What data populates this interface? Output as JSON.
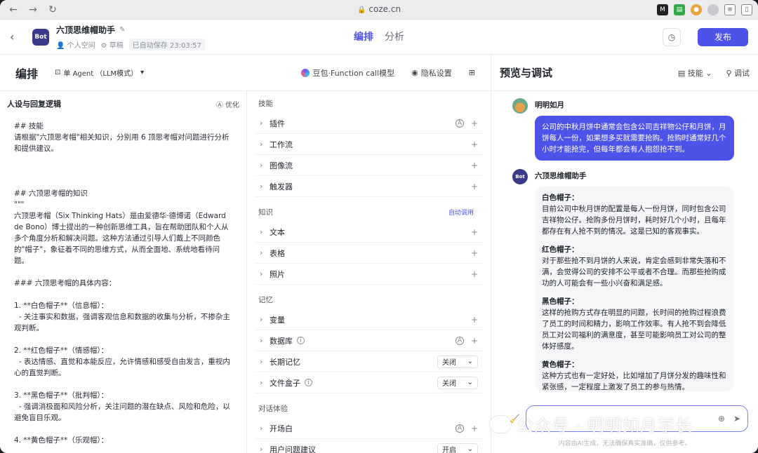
{
  "browser": {
    "url": "coze.cn",
    "lock_icon": "lock-icon"
  },
  "header": {
    "bot_avatar_text": "Bot",
    "bot_name": "六顶思维帽助手",
    "space": "个人空间",
    "draft": "草稿",
    "autosave": "已自动保存 23:03:57",
    "tabs": [
      "编排",
      "分析"
    ],
    "active_tab": "编排",
    "publish": "发布"
  },
  "editor": {
    "title": "编排",
    "mode": "单 Agent （LLM模式）",
    "model": "豆包·Function call模型",
    "privacy": "隐私设置"
  },
  "persona": {
    "title": "人设与回复逻辑",
    "optimize": "优化",
    "prompt": "## 技能\n请根据\"六顶思考帽\"相关知识，分别用 6 顶思考帽对问题进行分析和提供建议。\n\n\n\n## 六顶思考帽的知识\n\"\"\"\n六顶思考帽（Six Thinking Hats）是由爱德华·德博诺（Edward de Bono）博士提出的一种创新思维工具，旨在帮助团队和个人从多个角度分析和解决问题。这种方法通过引导人们戴上不同颜色的\"帽子\"，象征着不同的思维方式，从而全面地、系统地看待问题。\n\n### 六顶思考帽的具体内容：\n\n1. **白色帽子**（信息帽）：\n  - 关注事实和数据，强调客观信息和数据的收集与分析，不掺杂主观判断。\n\n2. **红色帽子**（情感帽）：\n  - 表达情感、直觉和本能反应，允许情感和感受自由发言，重视内心的直觉判断。\n\n3. **黑色帽子**（批判帽）：\n  - 强调消极面和风险分析，关注问题的潜在缺点、风险和危险，以避免盲目乐观。\n\n4. **黄色帽子**（乐观帽）："
  },
  "skills": {
    "sections": [
      {
        "label": "技能",
        "rows": [
          {
            "label": "插件",
            "a_icon": true
          },
          {
            "label": "工作流"
          },
          {
            "label": "图像流"
          },
          {
            "label": "触发器"
          }
        ]
      },
      {
        "label": "知识",
        "extra": "自动调用",
        "rows": [
          {
            "label": "文本"
          },
          {
            "label": "表格"
          },
          {
            "label": "照片"
          }
        ]
      },
      {
        "label": "记忆",
        "rows": [
          {
            "label": "变量"
          },
          {
            "label": "数据库",
            "info": true,
            "a_icon": true
          },
          {
            "label": "长期记忆",
            "select": "关闭"
          },
          {
            "label": "文件盒子",
            "info": true,
            "select": "关闭"
          }
        ]
      },
      {
        "label": "对话体验",
        "rows": [
          {
            "label": "开场白",
            "a_icon": true
          },
          {
            "label": "用户问题建议",
            "select": "开启"
          }
        ]
      }
    ]
  },
  "preview": {
    "title": "预览与调试",
    "skills": "技能",
    "debug": "调试",
    "user_name": "明明如月",
    "user_message": "公司的中秋月饼中通常会包含公司吉祥物公仔和月饼，月饼每人一份，如果想多买就需要抢购。抢购时通常好几个小时才能抢完，但每年都会有人抱怨抢不到。",
    "bot_name": "六顶思维帽助手",
    "bot_avatar_text": "Bot",
    "hats": [
      {
        "title": "白色帽子：",
        "text": "目前公司中秋月饼的配置是每人一份月饼，同时包含公司吉祥物公仔。抢购多份月饼时，耗时好几个小时，且每年都存在有人抢不到的情况。这是已知的客观事实。"
      },
      {
        "title": "红色帽子：",
        "text": "对于那些抢不到月饼的人来说，肯定会感到非常失落和不满，会觉得公司的安排不公平或者不合理。而那些抢购成功的人可能会有一些小兴奋和满足感。"
      },
      {
        "title": "黑色帽子：",
        "text": "这样的抢购方式存在明显的问题，长时间的抢购过程浪费了员工的时间和精力，影响工作效率。有人抢不到会降低员工对公司福利的满意度，甚至可能影响员工对公司的整体好感度。"
      },
      {
        "title": "黄色帽子：",
        "text": "这种方式也有一定好处，比如增加了月饼分发的趣味性和紧张感，一定程度上激发了员工的参与热情。"
      }
    ],
    "footer_note": "内容由AI生成，无法确保真实准确，仅供参考。",
    "watermark": "公众号 · 明明如月学长"
  }
}
